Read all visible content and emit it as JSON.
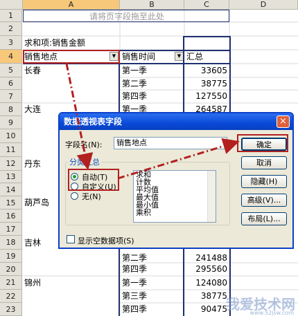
{
  "columns": [
    "A",
    "B",
    "C",
    "D"
  ],
  "rows": [
    "1",
    "2",
    "3",
    "4",
    "5",
    "6",
    "7",
    "8",
    "9",
    "10",
    "11",
    "12",
    "13",
    "14",
    "15",
    "16",
    "17",
    "18",
    "19",
    "20",
    "21",
    "22",
    "23"
  ],
  "page_drop_hint": "请将页字段拖至此处",
  "sum_label": "求和项:销售金额",
  "header_location": "销售地点",
  "header_time": "销售时间",
  "header_total": "汇总",
  "cities": {
    "r5": "长春",
    "r8": "大连",
    "r12": "丹东",
    "r15": "葫芦岛",
    "r18": "吉林",
    "r21": "锦州"
  },
  "quarters": {
    "r5": "第一季",
    "r6": "第二季",
    "r7": "第四季",
    "r8": "第一季",
    "r19": "第二季",
    "r20": "第四季",
    "r21": "第一季",
    "r22": "第三季",
    "r23": "第四季"
  },
  "values": {
    "r5": "33605",
    "r6": "38775",
    "r7": "127550",
    "r8": "264587",
    "r19": "241488",
    "r20": "295560",
    "r21": "124080",
    "r22": "38775",
    "r23": "90475"
  },
  "dialog": {
    "title": "数据透视表字段",
    "close": "×",
    "field_name_label": "字段名(N):",
    "field_name_value": "销售地点",
    "subtotal_group": "分类汇总",
    "radio_auto": "自动(T)",
    "radio_custom": "自定义(U)",
    "radio_none": "无(N)",
    "list_items": [
      "求和",
      "计数",
      "平均值",
      "最大值",
      "最小值",
      "乘积"
    ],
    "show_empty": "显示空数据项(S)",
    "btn_ok": "确定",
    "btn_cancel": "取消",
    "btn_hide": "隐藏(H)",
    "btn_advanced": "高级(V)...",
    "btn_layout": "布局(L)..."
  },
  "watermark": "我爱技术网",
  "watermark_sub": "www.52jsw.com"
}
